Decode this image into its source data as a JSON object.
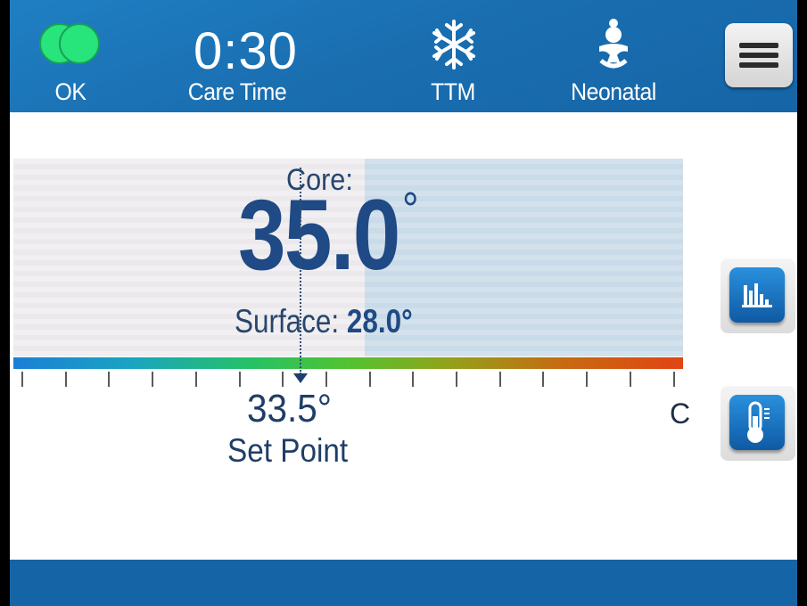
{
  "header": {
    "status_label": "OK",
    "care_time_value": "0:30",
    "care_time_label": "Care Time",
    "mode_label": "TTM",
    "patient_label": "Neonatal",
    "status_icon": "status-dots-icon",
    "mode_icon": "snowflake-icon",
    "patient_icon": "baby-icon",
    "menu_icon": "hamburger-menu-icon"
  },
  "main": {
    "core_label": "Core:",
    "core_value": "35.0",
    "degree": "°",
    "surface_label": "Surface:",
    "surface_value": "28.0°",
    "setpoint_value": "33.5°",
    "setpoint_label": "Set Point",
    "unit": "C"
  },
  "side_buttons": {
    "chart_icon": "bar-chart-icon",
    "thermometer_icon": "thermometer-icon"
  },
  "colors": {
    "header_blue": "#1a6fb1",
    "status_green": "#27e57a",
    "text_navy": "#1f4a85",
    "button_blue": "#1a74c2"
  }
}
